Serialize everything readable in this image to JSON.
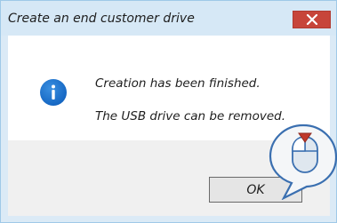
{
  "dialog": {
    "title": "Create an end customer drive",
    "message_line1": "Creation has been finished.",
    "message_line2": "The USB drive can be removed.",
    "ok_label": "OK",
    "close_icon": "close-icon",
    "info_icon": "info-icon"
  },
  "colors": {
    "titlebar": "#d6e8f6",
    "close_button": "#c7453a",
    "info_icon": "#1668c4",
    "click_marker": "#c0392b"
  }
}
